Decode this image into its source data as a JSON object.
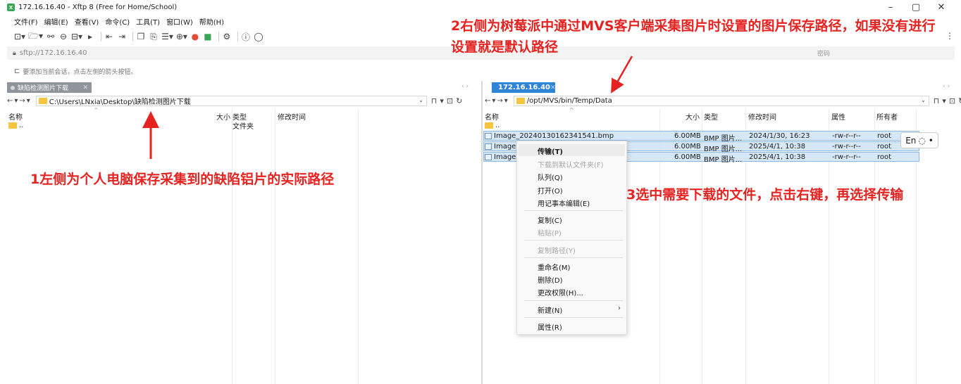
{
  "window": {
    "title": "172.16.16.40 - Xftp 8 (Free for Home/School)",
    "controls": [
      "–",
      "▢",
      "✕"
    ]
  },
  "menu": [
    "文件(F)",
    "编辑(E)",
    "查看(V)",
    "命令(C)",
    "工具(T)",
    "窗口(W)",
    "帮助(H)"
  ],
  "address": {
    "url": "sftp://172.16.16.40",
    "password_label": "密码"
  },
  "hint": "要添加当前会话，点击左侧的箭头按钮。",
  "tabs": {
    "left": "缺陷检测图片下载",
    "right": "172.16.16.40"
  },
  "left_pane": {
    "path": "C:\\Users\\LNxia\\Desktop\\缺陷检测图片下载",
    "columns": [
      "名称",
      "大小",
      "类型",
      "修改时间"
    ],
    "rows": [
      {
        "name": "..",
        "size": "",
        "type": "文件夹",
        "modified": ""
      }
    ]
  },
  "right_pane": {
    "path": "/opt/MVS/bin/Temp/Data",
    "columns": [
      "名称",
      "大小",
      "类型",
      "修改时间",
      "属性",
      "所有者"
    ],
    "parent": "..",
    "rows": [
      {
        "name": "Image_20240130162341541.bmp",
        "size": "6.00MB",
        "type": "BMP 图片...",
        "modified": "2024/1/30, 16:23",
        "attr": "-rw-r--r--",
        "owner": "root"
      },
      {
        "name": "Image",
        "size": "6.00MB",
        "type": "BMP 图片...",
        "modified": "2025/4/1, 10:38",
        "attr": "-rw-r--r--",
        "owner": "root"
      },
      {
        "name": "Image",
        "size": "6.00MB",
        "type": "BMP 图片...",
        "modified": "2025/4/1, 10:38",
        "attr": "-rw-r--r--",
        "owner": "root"
      }
    ]
  },
  "context_menu": {
    "transfer": "传输(T)",
    "download_default": "下载到默认文件夹(F)",
    "queue": "队列(Q)",
    "open": "打开(O)",
    "edit_notepad": "用记事本编辑(E)",
    "copy": "复制(C)",
    "paste": "粘贴(P)",
    "copy_path": "复制路径(Y)",
    "rename": "重命名(M)",
    "delete": "删除(D)",
    "permissions": "更改权限(H)...",
    "new": "新建(N)",
    "properties": "属性(R)"
  },
  "ime": {
    "label": "En",
    "symbol": "◌ •"
  },
  "annotations": {
    "one": "1左侧为个人电脑保存采集到的缺陷铝片的实际路径",
    "two": "2右侧为树莓派中通过MVS客户端采集图片时设置的图片保存路径，如果没有进行设置就是默认路径",
    "three": "3选中需要下载的文件，点击右键，再选择传输"
  },
  "colors": {
    "annotation": "#e52320",
    "tab_active": "#2f84d6",
    "selection": "#d6e8f7"
  }
}
